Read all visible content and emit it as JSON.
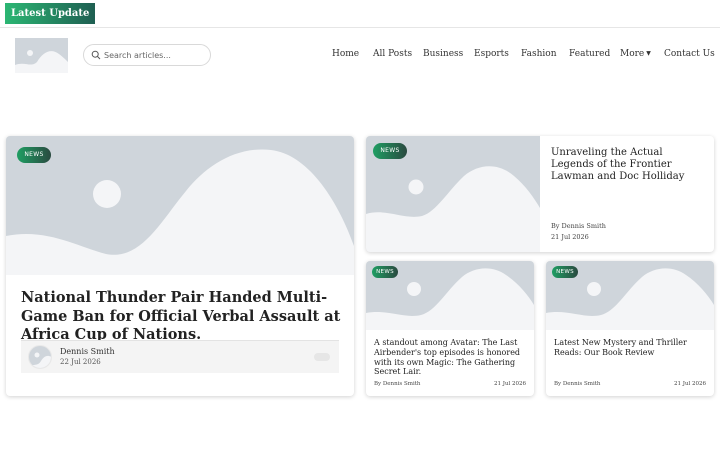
{
  "topbar": {
    "latest_label": "Latest Update"
  },
  "header": {
    "search": {
      "placeholder": "Search articles..."
    },
    "nav": [
      {
        "label": "Home"
      },
      {
        "label": "All Posts"
      },
      {
        "label": "Business"
      },
      {
        "label": "Esports"
      },
      {
        "label": "Fashion"
      },
      {
        "label": "Featured"
      },
      {
        "label": "More"
      },
      {
        "label": "Contact Us"
      }
    ]
  },
  "featured": {
    "tag": "NEWS",
    "title": "National Thunder Pair Handed Multi-Game Ban for Official Verbal Assault at Africa Cup of Nations.",
    "author": "Dennis Smith",
    "date": "22 Jul 2026"
  },
  "side_top": {
    "tag": "NEWS",
    "title": "Unraveling the Actual Legends of the Frontier Lawman and Doc Holliday",
    "byline": "By Dennis Smith",
    "date": "21 Jul 2026"
  },
  "grid": [
    {
      "tag": "NEWS",
      "title": "A standout among Avatar: The Last Airbender's top episodes is honored with its own Magic: The Gathering Secret Lair.",
      "byline": "By Dennis Smith",
      "date": "21 Jul 2026"
    },
    {
      "tag": "NEWS",
      "title": "Latest New Mystery and Thriller Reads: Our Book Review",
      "byline": "By Dennis Smith",
      "date": "21 Jul 2026"
    }
  ],
  "colors": {
    "accent_start": "#2bb673",
    "accent_end": "#1f5f52",
    "placeholder_bg": "#cfd5db"
  }
}
